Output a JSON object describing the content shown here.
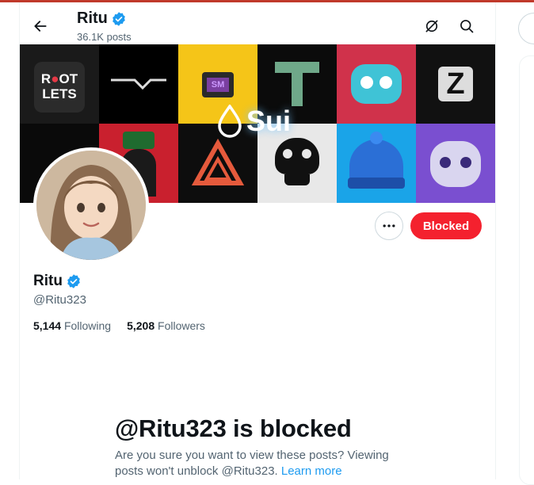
{
  "header": {
    "name": "Ritu",
    "posts": "36.1K posts"
  },
  "banner": {
    "logo_text": "Sui",
    "tiles": [
      "ROOT LETS",
      "SM",
      "T",
      "Z"
    ]
  },
  "profile": {
    "name": "Ritu",
    "handle": "@Ritu323",
    "following_count": "5,144",
    "following_label": "Following",
    "followers_count": "5,208",
    "followers_label": "Followers",
    "blocked_button": "Blocked"
  },
  "blocked_notice": {
    "title": "@Ritu323 is blocked",
    "text": "Are you sure you want to view these posts? Viewing posts won't unblock @Ritu323.",
    "link": "Learn more"
  },
  "colors": {
    "accent": "#1d9bf0",
    "blocked": "#f4212e",
    "muted": "#536471"
  },
  "icons": [
    "back-arrow-icon",
    "verified-badge-icon",
    "grok-icon",
    "search-icon",
    "more-icon"
  ]
}
